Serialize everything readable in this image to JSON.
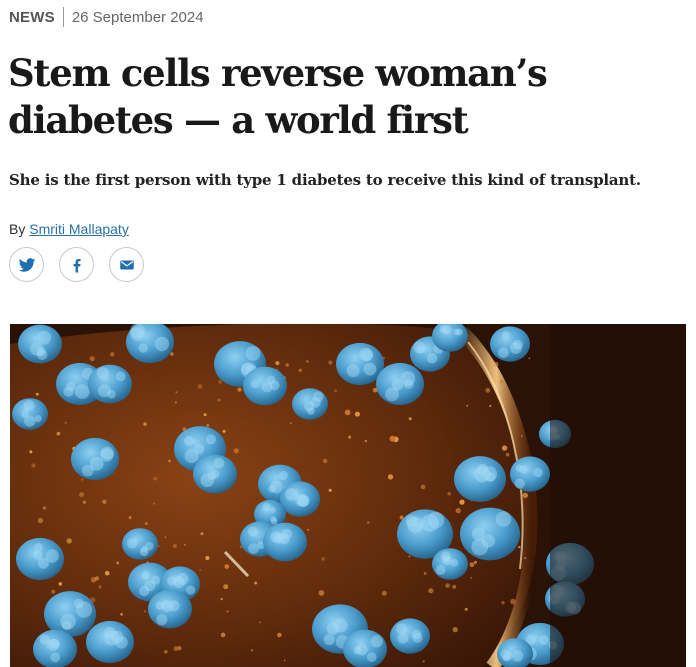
{
  "article": {
    "kind": "NEWS",
    "date": "26 September 2024",
    "title": "Stem cells reverse woman’s diabetes — a world first",
    "standfirst": "She is the first person with type 1 diabetes to receive this kind of transplant.",
    "byline_prefix": "By",
    "author": "Smriti Mallapaty"
  },
  "share": {
    "buttons": [
      {
        "icon": "twitter-icon",
        "label": "Share on Twitter"
      },
      {
        "icon": "facebook-icon",
        "label": "Share on Facebook"
      },
      {
        "icon": "email-icon",
        "label": "Share via email"
      }
    ]
  },
  "hero_image": {
    "subject": "false-colour micrograph of cells",
    "colors": {
      "background": "#2a1206",
      "cell_body": "#7a3a12",
      "membrane": "#e8a04a",
      "particles": "#d98c3c",
      "clusters": "#4fa6d6"
    }
  },
  "colors": {
    "link": "#2a6fa5",
    "text": "#191919",
    "meta": "#555555",
    "border": "#c9c9c9",
    "twitter": "#1d6fb0",
    "facebook": "#1d6fb0",
    "email": "#1d6fb0"
  }
}
